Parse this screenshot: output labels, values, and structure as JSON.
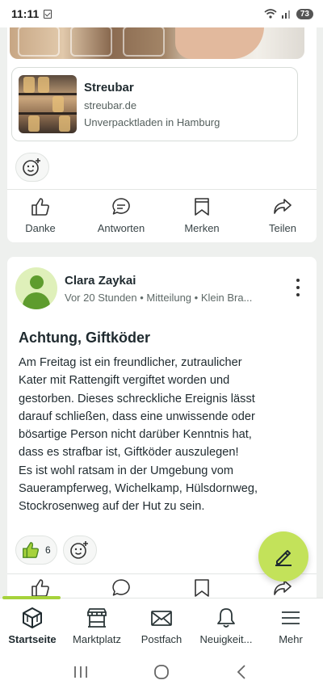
{
  "status_bar": {
    "time": "11:11",
    "battery": "73"
  },
  "link_preview": {
    "title": "Streubar",
    "url": "streubar.de",
    "description": "Unverpacktladen in Hamburg"
  },
  "post_actions": [
    {
      "label": "Danke",
      "icon": "thumbs-up-icon"
    },
    {
      "label": "Antworten",
      "icon": "speech-bubble-icon"
    },
    {
      "label": "Merken",
      "icon": "bookmark-icon"
    },
    {
      "label": "Teilen",
      "icon": "share-arrow-icon"
    }
  ],
  "post": {
    "author": "Clara Zaykai",
    "meta": "Vor 20 Stunden • Mitteilung • Klein Bra...",
    "title": "Achtung, Giftköder",
    "body": [
      "Am Freitag ist ein freundlicher, zutraulicher",
      "Kater mit Rattengift vergiftet worden und",
      "gestorben. Dieses schreckliche Ereignis lässt",
      "darauf schließen, dass eine unwissende oder",
      "bösartige Person nicht darüber Kenntnis hat,",
      "dass es strafbar ist, Giftköder auszulegen!",
      "Es ist wohl ratsam in der Umgebung vom",
      "Sauerampferweg, Wichelkamp, Hülsdornweg,",
      "Stockrosenweg auf der Hut zu sein."
    ],
    "like_count": "6"
  },
  "bottom_nav": [
    {
      "label": "Startseite",
      "icon": "house-cube-icon",
      "active": true
    },
    {
      "label": "Marktplatz",
      "icon": "market-stall-icon",
      "active": false
    },
    {
      "label": "Postfach",
      "icon": "envelope-icon",
      "active": false
    },
    {
      "label": "Neuigkeit...",
      "icon": "bell-icon",
      "active": false
    },
    {
      "label": "Mehr",
      "icon": "hamburger-menu-icon",
      "active": false
    }
  ],
  "colors": {
    "accent": "#a6d23b",
    "fab": "#c3e25a",
    "like_green": "#5e9c2e"
  }
}
